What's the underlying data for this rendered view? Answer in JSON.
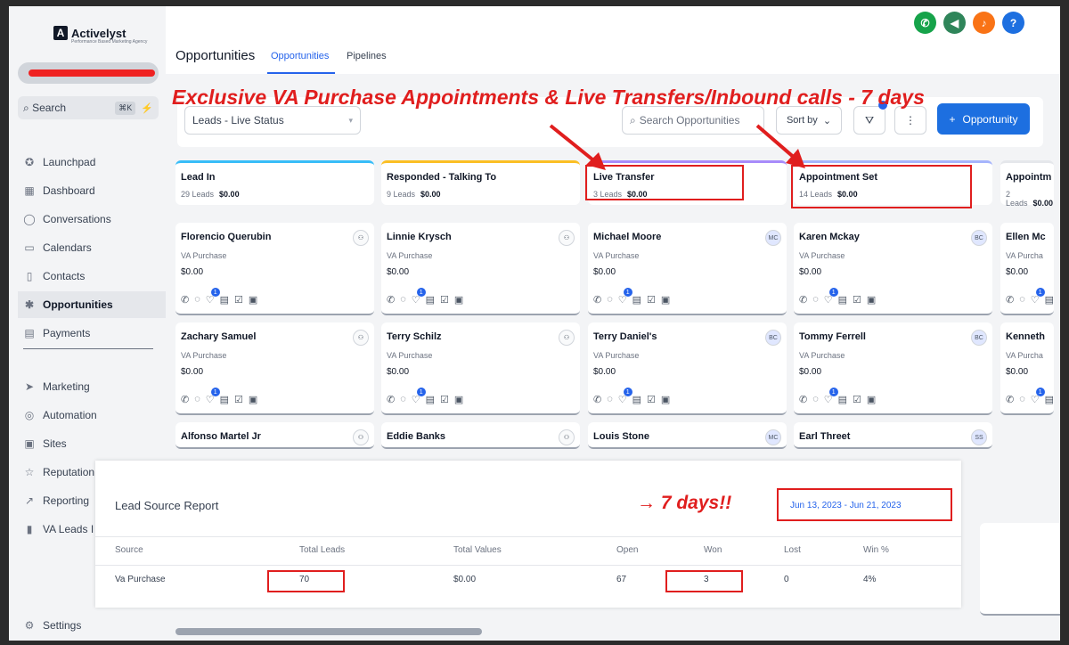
{
  "brand": {
    "name": "Activelyst",
    "tagline": "Performance Based Marketing Agency"
  },
  "sidebar": {
    "search_label": "Search",
    "search_kbd": "⌘K",
    "items": [
      {
        "label": "Launchpad",
        "icon": "rocket-icon"
      },
      {
        "label": "Dashboard",
        "icon": "grid-icon"
      },
      {
        "label": "Conversations",
        "icon": "chat-icon"
      },
      {
        "label": "Calendars",
        "icon": "calendar-icon"
      },
      {
        "label": "Contacts",
        "icon": "contacts-icon"
      },
      {
        "label": "Opportunities",
        "icon": "opportunities-icon",
        "active": true
      },
      {
        "label": "Payments",
        "icon": "payments-icon"
      },
      {
        "label": "Marketing",
        "icon": "send-icon"
      },
      {
        "label": "Automation",
        "icon": "automation-icon"
      },
      {
        "label": "Sites",
        "icon": "sites-icon"
      },
      {
        "label": "Reputation",
        "icon": "star-icon"
      },
      {
        "label": "Reporting",
        "icon": "chart-icon"
      },
      {
        "label": "VA Leads I",
        "icon": "file-icon"
      },
      {
        "label": "Settings",
        "icon": "gear-icon"
      }
    ]
  },
  "header": {
    "title": "Opportunities",
    "tabs": [
      {
        "label": "Opportunities",
        "active": true
      },
      {
        "label": "Pipelines"
      }
    ],
    "icons": [
      {
        "name": "phone-icon",
        "glyph": "✆",
        "color": "#16a34a"
      },
      {
        "name": "megaphone-icon",
        "glyph": "◀",
        "color": "#2f855a"
      },
      {
        "name": "bell-icon",
        "glyph": "♪",
        "color": "#f97316"
      },
      {
        "name": "help-icon",
        "glyph": "?",
        "color": "#1d6fe0"
      }
    ]
  },
  "toolbar": {
    "pipeline_select": "Leads - Live Status",
    "search_placeholder": "Search Opportunities",
    "sort_label": "Sort by",
    "add_label": "Opportunity"
  },
  "annotations": {
    "headline": "Exclusive VA Purchase Appointments & Live Transfers/Inbound calls - 7 days",
    "days_note": "→ 7 days!!"
  },
  "columns": [
    {
      "name": "Lead In",
      "leads": "29 Leads",
      "value": "$0.00",
      "accent": "#38bdf8"
    },
    {
      "name": "Responded - Talking To",
      "leads": "9 Leads",
      "value": "$0.00",
      "accent": "#fbbf24"
    },
    {
      "name": "Live Transfer",
      "leads": "3 Leads",
      "value": "$0.00",
      "accent": "#a78bfa"
    },
    {
      "name": "Appointment Set",
      "leads": "14 Leads",
      "value": "$0.00",
      "accent": "#a5b4fc"
    },
    {
      "name": "Appointm",
      "leads": "2 Leads",
      "value": "$0.00",
      "accent": "#e5e7eb"
    }
  ],
  "cards": [
    [
      {
        "name": "Florencio Querubin",
        "src": "VA Purchase",
        "amt": "$0.00",
        "avatar": ""
      },
      {
        "name": "Zachary Samuel",
        "src": "VA Purchase",
        "amt": "$0.00",
        "avatar": ""
      },
      {
        "name": "Alfonso Martel Jr",
        "avatar": ""
      }
    ],
    [
      {
        "name": "Linnie Krysch",
        "src": "VA Purchase",
        "amt": "$0.00",
        "avatar": ""
      },
      {
        "name": "Terry Schilz",
        "src": "VA Purchase",
        "amt": "$0.00",
        "avatar": ""
      },
      {
        "name": "Eddie Banks",
        "avatar": ""
      }
    ],
    [
      {
        "name": "Michael Moore",
        "src": "VA Purchase",
        "amt": "$0.00",
        "avatar": "MC"
      },
      {
        "name": "Terry Daniel's",
        "src": "VA Purchase",
        "amt": "$0.00",
        "avatar": "BC"
      },
      {
        "name": "Louis Stone",
        "avatar": "MC"
      }
    ],
    [
      {
        "name": "Karen Mckay",
        "src": "VA Purchase",
        "amt": "$0.00",
        "avatar": "BC"
      },
      {
        "name": "Tommy Ferrell",
        "src": "VA Purchase",
        "amt": "$0.00",
        "avatar": "BC"
      },
      {
        "name": "Earl Threet",
        "avatar": "SS"
      }
    ],
    [
      {
        "name": "Ellen Mc",
        "src": "VA Purcha",
        "amt": "$0.00",
        "avatar": ""
      },
      {
        "name": "Kenneth",
        "src": "VA Purcha",
        "amt": "$0.00",
        "avatar": ""
      }
    ]
  ],
  "report": {
    "title": "Lead Source Report",
    "date_range": "Jun 13, 2023 - Jun 21, 2023",
    "headers": [
      "Source",
      "Total Leads",
      "Total Values",
      "Open",
      "Won",
      "Lost",
      "Win %"
    ],
    "row": [
      "Va Purchase",
      "70",
      "$0.00",
      "67",
      "3",
      "0",
      "4%"
    ]
  },
  "extra_avatar": "BC"
}
